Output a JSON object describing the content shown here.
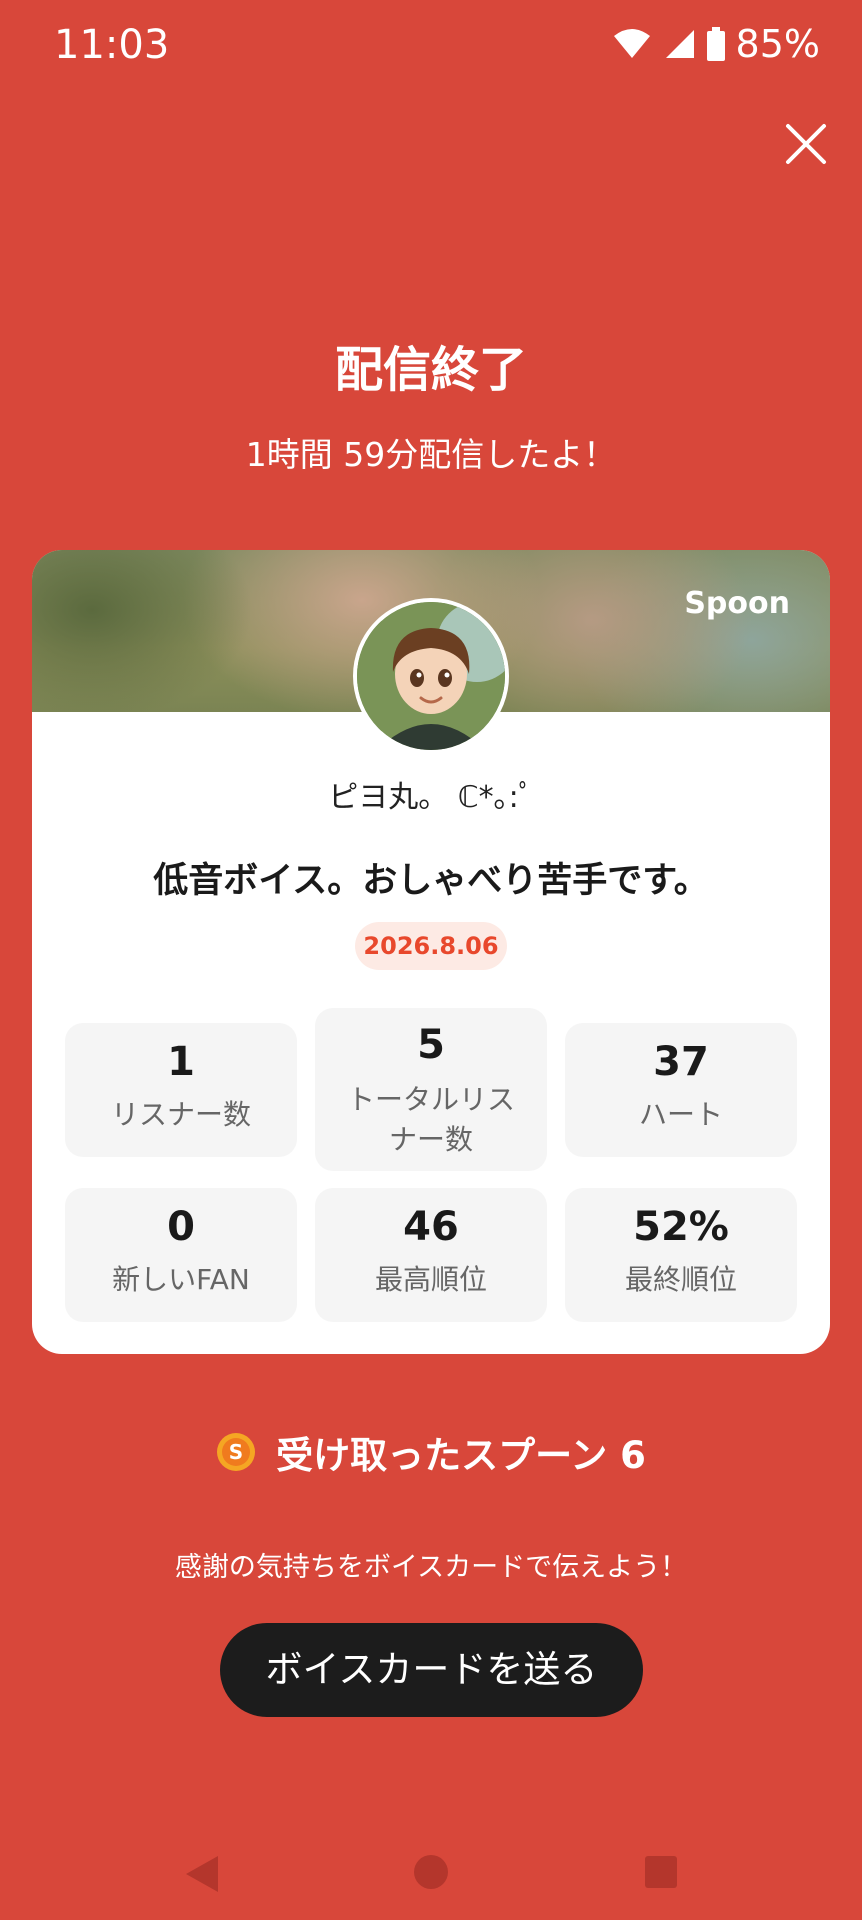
{
  "status_bar": {
    "time": "11:03",
    "battery": "85%"
  },
  "header": {
    "title": "配信終了",
    "subtitle": "1時間 59分配信したよ！"
  },
  "card": {
    "brand": "Spoon",
    "username": "ピヨ丸。 ℂ*｡:ﾟ",
    "show_title": "低音ボイス。おしゃべり苦手です。",
    "date": "2026.8.06",
    "stats": [
      {
        "value": "1",
        "label": "リスナー数"
      },
      {
        "value": "5",
        "label": "トータルリスナー数"
      },
      {
        "value": "37",
        "label": "ハート"
      },
      {
        "value": "0",
        "label": "新しいFAN"
      },
      {
        "value": "46",
        "label": "最高順位"
      },
      {
        "value": "52%",
        "label": "最終順位"
      }
    ]
  },
  "spoons": {
    "coin_letter": "S",
    "label": "受け取ったスプーン 6"
  },
  "message": "感謝の気持ちをボイスカードで伝えよう！",
  "send_button": "ボイスカードを送る",
  "colors": {
    "background": "#D8473A",
    "accent": "#E8482C",
    "button": "#1c1c1c"
  }
}
